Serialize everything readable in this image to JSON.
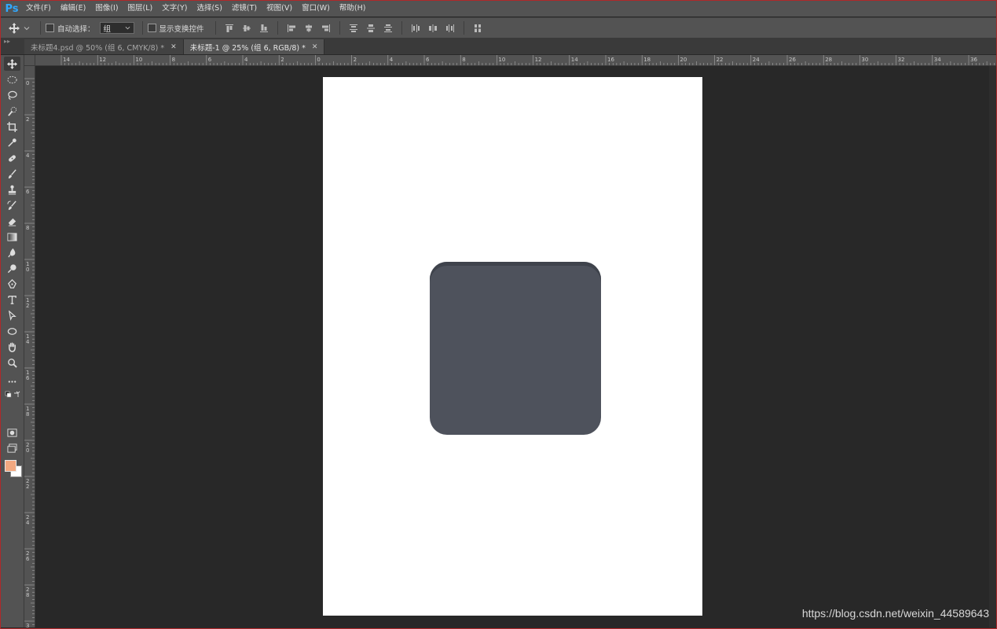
{
  "app": {
    "logo": "Ps"
  },
  "menu": [
    "文件(F)",
    "编辑(E)",
    "图像(I)",
    "图层(L)",
    "文字(Y)",
    "选择(S)",
    "滤镜(T)",
    "视图(V)",
    "窗口(W)",
    "帮助(H)"
  ],
  "options": {
    "auto_select_label": "自动选择：",
    "auto_select_value": "组",
    "show_transform_label": "显示变换控件"
  },
  "tabs": [
    {
      "label": "未标题4.psd @ 50% (组 6, CMYK/8) *",
      "active": false
    },
    {
      "label": "未标题-1 @ 25% (组 6, RGB/8) *",
      "active": true
    }
  ],
  "ruler": {
    "h_labels": [
      "14",
      "12",
      "10",
      "8",
      "6",
      "4",
      "2",
      "0",
      "2",
      "4",
      "6",
      "8",
      "10",
      "12",
      "14",
      "16",
      "18",
      "20",
      "22",
      "24",
      "26",
      "28",
      "30",
      "32",
      "34",
      "36"
    ],
    "v_labels": [
      "0",
      "2",
      "4",
      "6",
      "8",
      "10",
      "12",
      "14",
      "16",
      "18",
      "20",
      "22",
      "24",
      "26",
      "28",
      "3"
    ]
  },
  "colors": {
    "foreground": "#f2a880",
    "background": "#ffffff",
    "shape_fill": "#4e525c"
  },
  "watermark": "https://blog.csdn.net/weixin_44589643"
}
